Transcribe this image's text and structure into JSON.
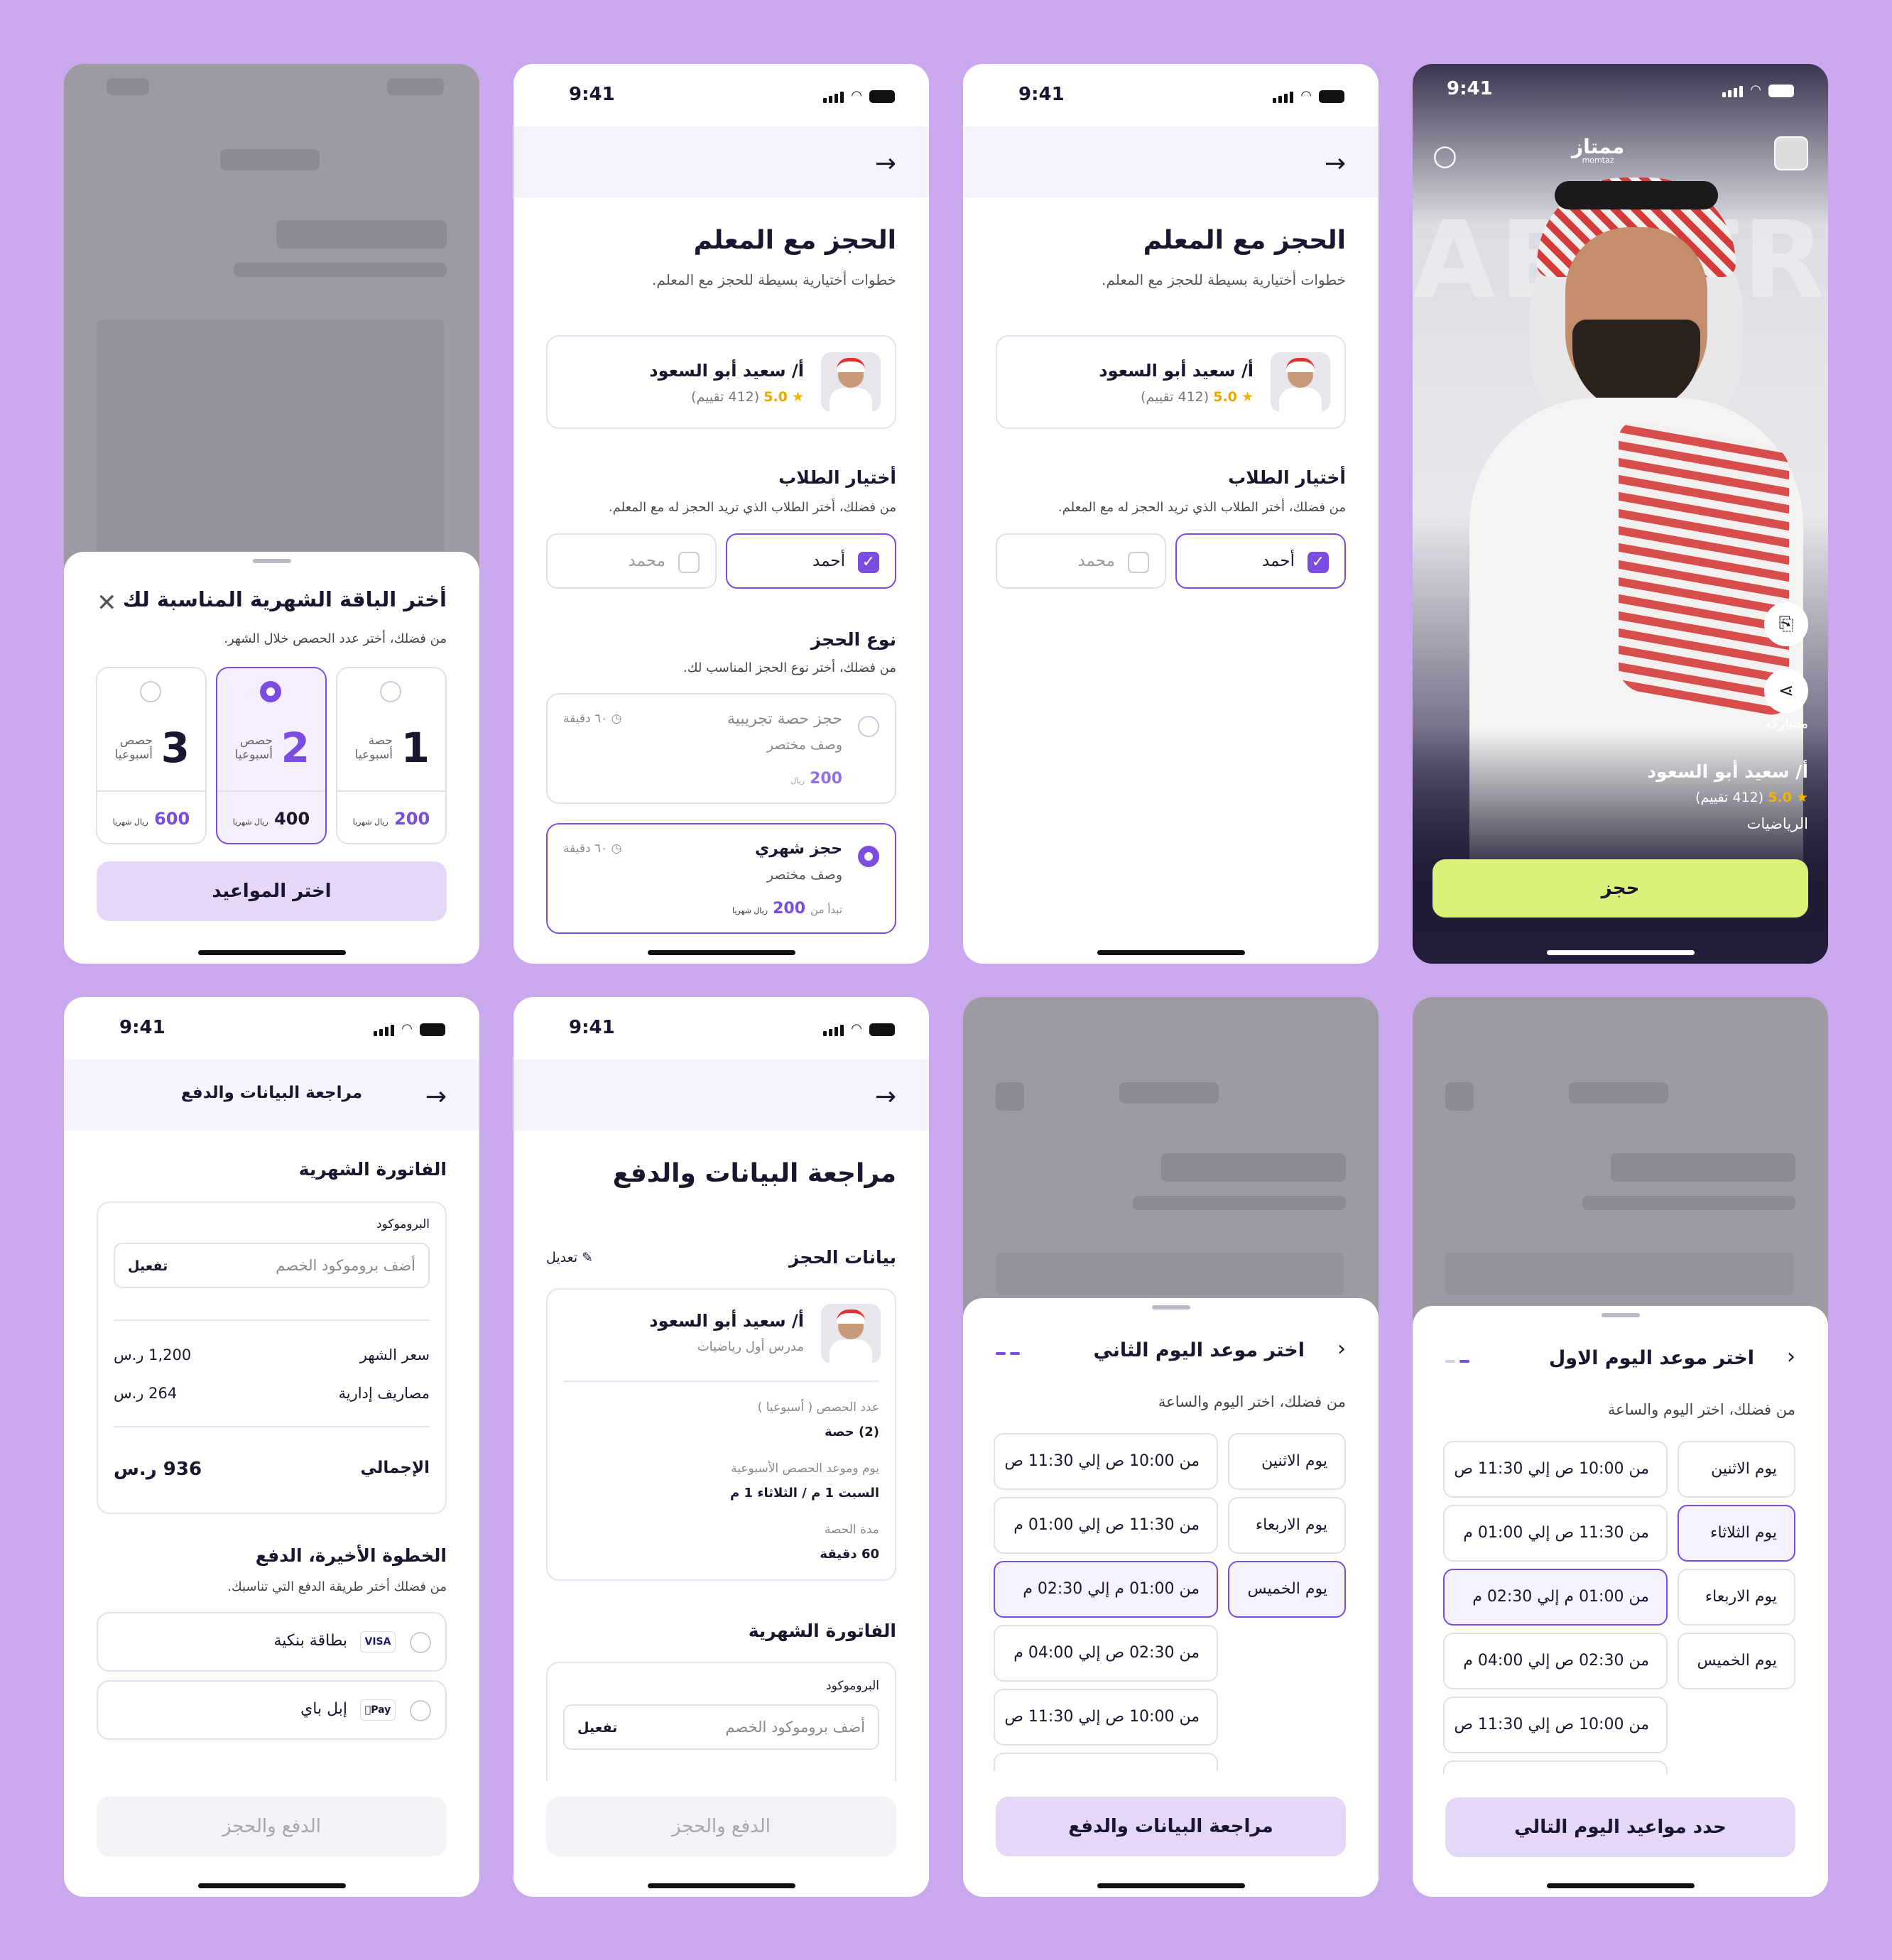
{
  "status": {
    "time": "9:41"
  },
  "booking": {
    "title": "الحجز مع المعلم",
    "subtitle": "خطوات أختيارية بسيطة للحجز مع المعلم.",
    "teacher_name": "أ/ سعيد أبو السعود",
    "rating": "5.0",
    "rating_count": "(412 تقييم)",
    "students_title": "أختيار الطلاب",
    "students_sub": "من فضلك، أختر الطلاب الذي تريد الحجز له مع المعلم.",
    "student1": "أحمد",
    "student2": "محمد",
    "type_title": "نوع الحجز",
    "type_sub": "من فضلك، أختر نوع الحجز المناسب لك.",
    "trial": {
      "title": "حجز حصة تجريبية",
      "desc": "وصف مختصر",
      "duration": "٦٠ دقيقة",
      "price": "200",
      "currency": "ريال"
    },
    "monthly": {
      "title": "حجز شهري",
      "desc": "وصف مختصر",
      "duration": "٦٠ دقيقة",
      "from": "تبدأ من",
      "price": "200",
      "currency": "ريال شهريا"
    }
  },
  "profile": {
    "logo": "ممتاز",
    "logo_latin": "momtaz",
    "share": "مشاركة",
    "name": "أ/ سعيد أبو السعود",
    "rating": "5.0",
    "rating_count": "(412 تقييم)",
    "subject": "الرياضيات",
    "book_button": "حجز",
    "watermark": "ABSTR"
  },
  "packages": {
    "title": "أختر الباقة الشهرية المناسبة لك",
    "subtitle": "من فضلك، أختر عدد الحصص خلال الشهر.",
    "items": [
      {
        "count": "1",
        "unit1": "حصة",
        "unit2": "أسبوعيا",
        "price": "200",
        "per": "ريال شهريا"
      },
      {
        "count": "2",
        "unit1": "حصص",
        "unit2": "أسبوعيا",
        "price": "400",
        "per": "ريال شهريا"
      },
      {
        "count": "3",
        "unit1": "حصص",
        "unit2": "أسبوعيا",
        "price": "600",
        "per": "ريال شهريا"
      }
    ],
    "button": "اختر المواعيد"
  },
  "review": {
    "header": "مراجعة البيانات والدفع",
    "invoice_title": "الفاتورة الشهرية",
    "promo_label": "البروموكود",
    "promo_placeholder": "أضف بروموكود الخصم",
    "promo_apply": "تفعيل",
    "month_price_label": "سعر الشهر",
    "month_price": "1,200 ر.س",
    "admin_fees_label": "مصاريف إدارية",
    "admin_fees": "264 ر.س",
    "total_label": "الإجمالي",
    "total": "936 ر.س",
    "pay_title": "الخطوة الأخيرة، الدفع",
    "pay_sub": "من فضلك أختر طريقة الدفع التي تناسبك.",
    "card_label": "بطاقة بنكية",
    "card_tag": "VISA",
    "apple_label": "إبل باي",
    "apple_tag": "Pay",
    "pay_button": "الدفع والحجز"
  },
  "review2": {
    "title": "مراجعة البيانات والدفع",
    "booking_data": "بيانات الحجز",
    "edit": "تعديل",
    "teacher_name": "أ/ سعيد أبو السعود",
    "teacher_role": "مدرس أول رياضيات",
    "sessions_label": "عدد الحصص ( أسبوعيا )",
    "sessions_value": "(2) حصة",
    "schedule_label": "يوم وموعد الحصص الأسبوعية",
    "schedule_value": "السبت  1 م / الثلاثاء 1 م",
    "duration_label": "مدة الحصة",
    "duration_value": "60 دقيقة",
    "invoice_title": "الفاتورة الشهرية",
    "promo_label": "البروموكود",
    "promo_placeholder": "أضف بروموكود الخصم",
    "promo_apply": "تفعيل",
    "pay_button": "الدفع والحجز"
  },
  "day2": {
    "title": "اختر موعد اليوم الثاني",
    "subtitle": "من فضلك، اختر اليوم والساعة",
    "days": [
      "يوم الاثنين",
      "يوم الاربعاء",
      "يوم الخميس"
    ],
    "times": [
      "من 10:00 ص إلي 11:30 ص",
      "من 11:30 ص إلي 01:00 م",
      "من 01:00 م إلي 02:30 م",
      "من 02:30 ص إلي 04:00 م",
      "من 10:00 ص إلي 11:30 ص"
    ],
    "button": "مراجعة البيانات والدفع"
  },
  "day1": {
    "title": "اختر موعد اليوم الاول",
    "subtitle": "من فضلك، اختر اليوم والساعة",
    "days": [
      "يوم الاثنين",
      "يوم الثلاثاء",
      "يوم الاربعاء",
      "يوم الخميس"
    ],
    "times": [
      "من 10:00 ص إلي 11:30 ص",
      "من 11:30 ص إلي 01:00 م",
      "من 01:00 م إلي 02:30 م",
      "من 02:30 ص إلي 04:00 م",
      "من 10:00 ص إلي 11:30 ص"
    ],
    "button": "حدد مواعيد اليوم التالي"
  },
  "colors": {
    "accent": "#7B4CE0",
    "lime": "#D8F27A",
    "bg": "#C9A8EE",
    "soft": "#E4D7F7"
  }
}
